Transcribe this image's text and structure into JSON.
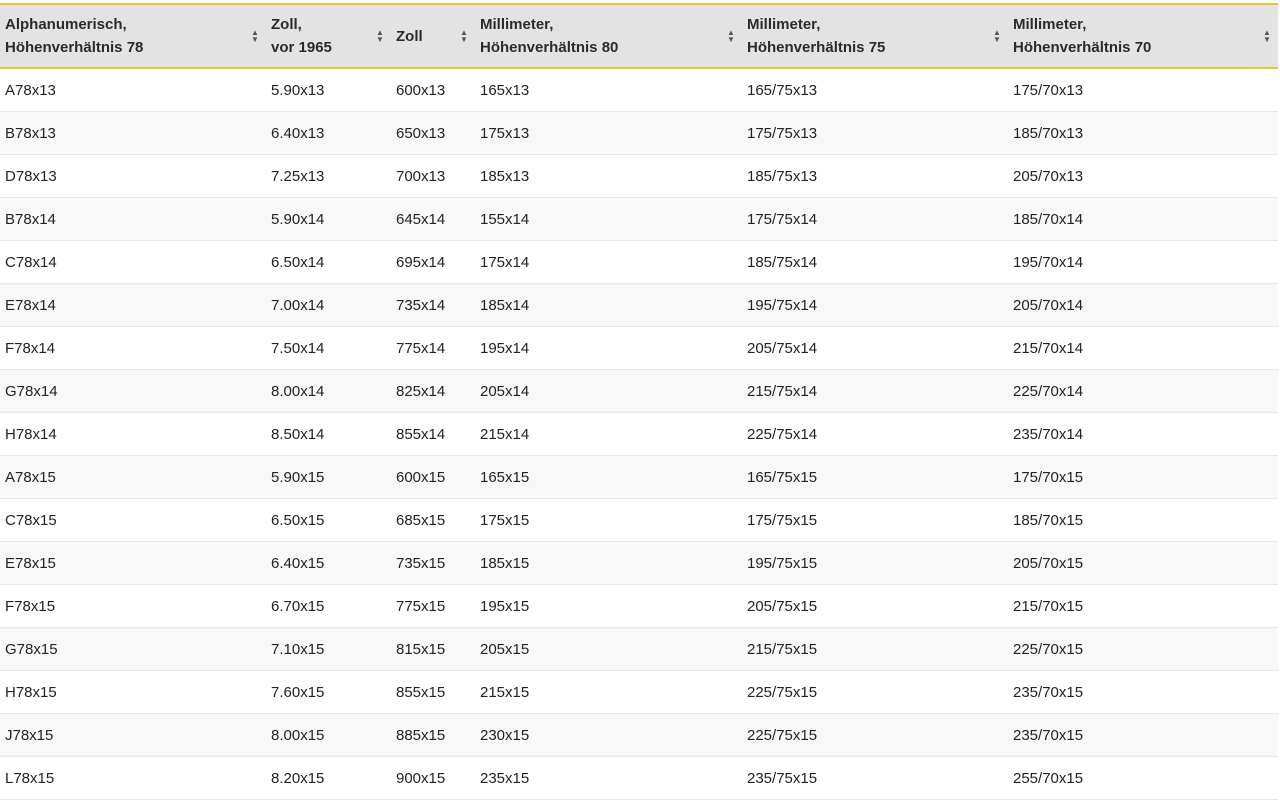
{
  "table": {
    "columns": [
      {
        "line1": "Alphanumerisch,",
        "line2": "Höhenverhältnis 78"
      },
      {
        "line1": "Zoll,",
        "line2": "vor 1965"
      },
      {
        "line1": "Zoll",
        "line2": ""
      },
      {
        "line1": "Millimeter,",
        "line2": "Höhenverhältnis 80"
      },
      {
        "line1": "Millimeter,",
        "line2": "Höhenverhältnis 75"
      },
      {
        "line1": "Millimeter,",
        "line2": "Höhenverhältnis 70"
      }
    ],
    "sort_icon": "sort-updown-icon",
    "rows": [
      [
        "A78x13",
        "5.90x13",
        "600x13",
        "165x13",
        "165/75x13",
        "175/70x13"
      ],
      [
        "B78x13",
        "6.40x13",
        "650x13",
        "175x13",
        "175/75x13",
        "185/70x13"
      ],
      [
        "D78x13",
        "7.25x13",
        "700x13",
        "185x13",
        "185/75x13",
        "205/70x13"
      ],
      [
        "B78x14",
        "5.90x14",
        "645x14",
        "155x14",
        "175/75x14",
        "185/70x14"
      ],
      [
        "C78x14",
        "6.50x14",
        "695x14",
        "175x14",
        "185/75x14",
        "195/70x14"
      ],
      [
        "E78x14",
        "7.00x14",
        "735x14",
        "185x14",
        "195/75x14",
        "205/70x14"
      ],
      [
        "F78x14",
        "7.50x14",
        "775x14",
        "195x14",
        "205/75x14",
        "215/70x14"
      ],
      [
        "G78x14",
        "8.00x14",
        "825x14",
        "205x14",
        "215/75x14",
        "225/70x14"
      ],
      [
        "H78x14",
        "8.50x14",
        "855x14",
        "215x14",
        "225/75x14",
        "235/70x14"
      ],
      [
        "A78x15",
        "5.90x15",
        "600x15",
        "165x15",
        "165/75x15",
        "175/70x15"
      ],
      [
        "C78x15",
        "6.50x15",
        "685x15",
        "175x15",
        "175/75x15",
        "185/70x15"
      ],
      [
        "E78x15",
        "6.40x15",
        "735x15",
        "185x15",
        "195/75x15",
        "205/70x15"
      ],
      [
        "F78x15",
        "6.70x15",
        "775x15",
        "195x15",
        "205/75x15",
        "215/70x15"
      ],
      [
        "G78x15",
        "7.10x15",
        "815x15",
        "205x15",
        "215/75x15",
        "225/70x15"
      ],
      [
        "H78x15",
        "7.60x15",
        "855x15",
        "215x15",
        "225/75x15",
        "235/70x15"
      ],
      [
        "J78x15",
        "8.00x15",
        "885x15",
        "230x15",
        "225/75x15",
        "235/70x15"
      ],
      [
        "L78x15",
        "8.20x15",
        "900x15",
        "235x15",
        "235/75x15",
        "255/70x15"
      ]
    ]
  },
  "colors": {
    "header_bg": "#e3e3e3",
    "header_border": "#f2c230",
    "row_alt_bg": "#f8f8f8"
  }
}
